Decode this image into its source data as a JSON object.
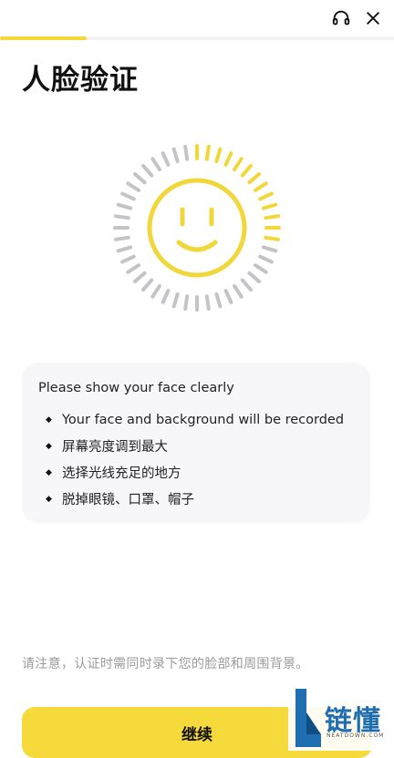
{
  "header": {
    "support_icon": "headset-icon",
    "close_icon": "close-icon",
    "progress": 0.22,
    "accent_color": "#f5d83a"
  },
  "title": "人脸验证",
  "face_graphic": {
    "icon": "smiley-face-icon",
    "arc_progress": 0.3,
    "active_color": "#f2d73a",
    "inactive_color": "#c4c4c8"
  },
  "instructions": {
    "title": "Please show your face clearly",
    "items": [
      "Your face and background will be recorded",
      "屏幕亮度调到最大",
      "选择光线充足的地方",
      "脱掉眼镜、口罩、帽子"
    ]
  },
  "notice": "请注意，认证时需同时录下您的脸部和周围背景。",
  "continue_button": {
    "label": "继续"
  },
  "watermark": {
    "text": "链懂",
    "sub": "NEATDOWN.COM"
  }
}
